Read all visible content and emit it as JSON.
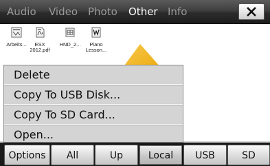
{
  "tabs": [
    {
      "label": "Audio",
      "active": false
    },
    {
      "label": "Video",
      "active": false
    },
    {
      "label": "Photo",
      "active": false
    },
    {
      "label": "Other",
      "active": true
    },
    {
      "label": "Info",
      "active": false
    }
  ],
  "close_icon": "close-x-icon",
  "files": [
    {
      "line1": "Arbeits...",
      "line2": "",
      "icon": "document-icon"
    },
    {
      "line1": "ESX",
      "line2": "2012.pdf",
      "icon": "pdf-icon"
    },
    {
      "line1": "HND_2...",
      "line2": "",
      "icon": "spreadsheet-icon"
    },
    {
      "line1": "Piano",
      "line2": "Lesson...",
      "icon": "word-document-icon"
    }
  ],
  "context_menu": {
    "items": [
      "Delete",
      "Copy To USB Disk...",
      "Copy To SD Card...",
      "Open..."
    ]
  },
  "bottom_bar": {
    "buttons": [
      {
        "label": "Options",
        "active": false
      },
      {
        "label": "All",
        "active": false
      },
      {
        "label": "Up",
        "active": false
      },
      {
        "label": "Local",
        "active": true
      },
      {
        "label": "USB",
        "active": false
      },
      {
        "label": "SD",
        "active": false
      }
    ]
  },
  "colors": {
    "pointer_arrow": "#f2b414",
    "active_tab_text": "#ffffff",
    "inactive_tab_text": "#9a9a9a"
  }
}
